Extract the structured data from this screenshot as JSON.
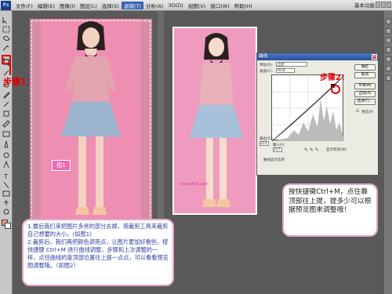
{
  "menubar": {
    "logo": "Ps",
    "items": [
      "文件(F)",
      "编辑(E)",
      "图像(I)",
      "图层(L)",
      "选择(S)",
      "滤镜(T)",
      "分析(A)",
      "3D(D)",
      "视图(V)",
      "窗口(W)",
      "帮助(H)"
    ],
    "active_index": 5,
    "zoom": "66.7",
    "workspace": "基本功能"
  },
  "annotations": {
    "step1": "步骤1：",
    "step2": "步骤2：",
    "fig1": "图1",
    "note": "按快捷键Ctrl+M，点住靠顶部往上提，提多少可以根据预览图来调整哦！",
    "instructions": [
      "1.最后我们来把图片多余的部分去掉，用裁剪工具来裁剪自己想要的大小。(如图1)",
      "2.裁剪后，我们再把颜色调亮点，让图片更加好看些。按快捷键 Ctrl+M 进行曲线调整，步骤和上次调整的一样，点住曲线的靠顶部位置往上提一点点，可以看看预览图调整哦。（如图2）"
    ],
    "watermark": "lovelyfish.com"
  },
  "curves_dialog": {
    "title": "曲线",
    "preset_label": "预设(R):",
    "preset_value": "自定",
    "channel_label": "通道(C):",
    "channel_value": "RGB",
    "output_label": "输出(O):",
    "output_value": "222",
    "input_label": "输入(I):",
    "input_value": "217",
    "buttons": [
      "确定",
      "取消",
      "平滑(M)",
      "自动(A)",
      "选项(T)..."
    ],
    "preview_label": "预览(P)",
    "show_clipping_label": "显示修剪(W)",
    "curve_display_options": "曲线显示选项"
  },
  "colors": {
    "canvas_pink": "#ee8eb2",
    "annotation_red": "#e00000",
    "bubble_border": "#e4a6c6",
    "instruction_text": "#2a3da0",
    "titlebar_blue": "#3a63b5"
  }
}
